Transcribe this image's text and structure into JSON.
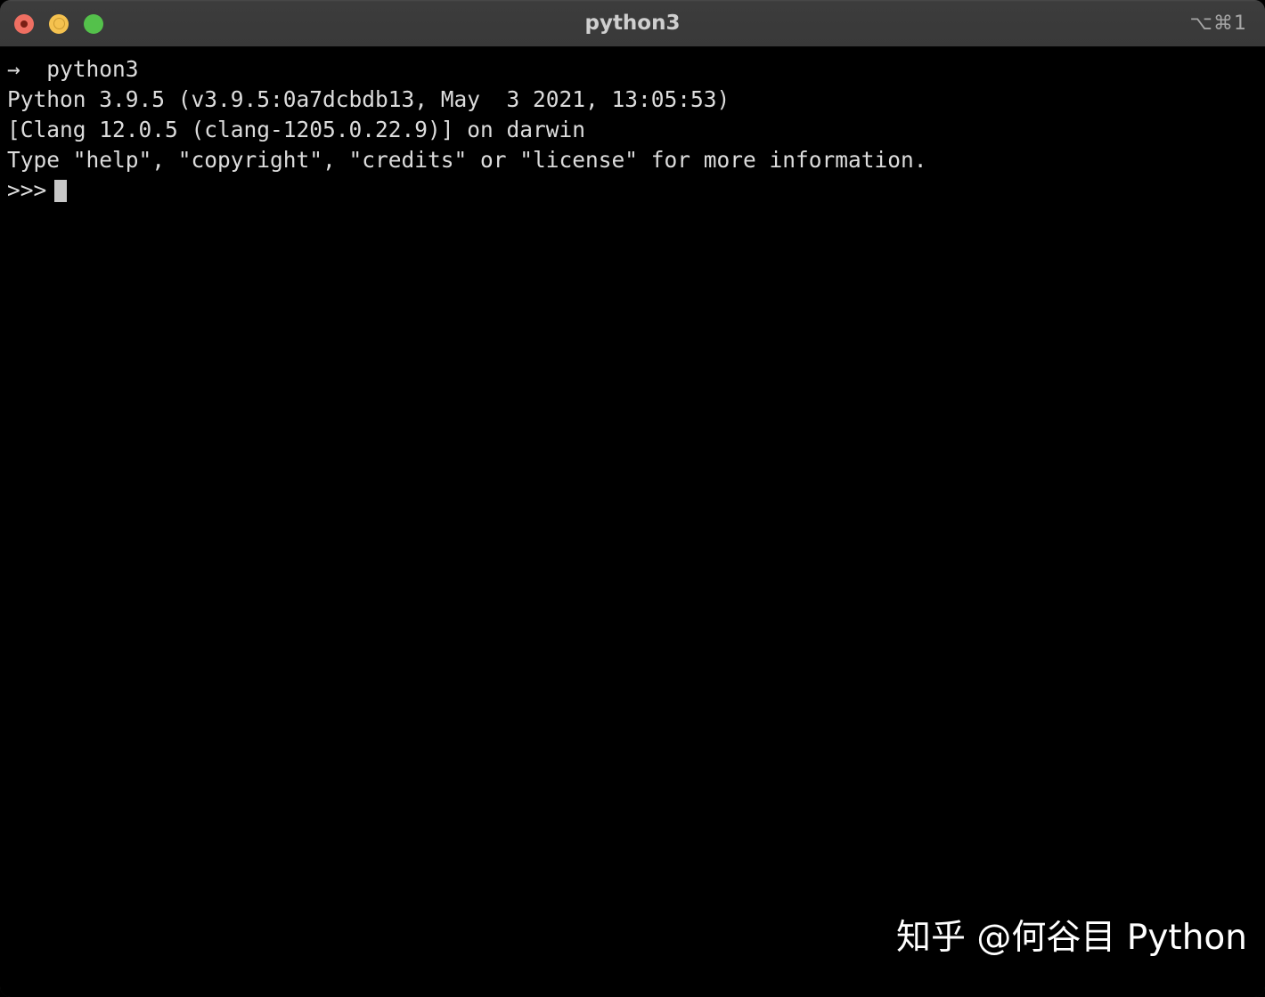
{
  "window": {
    "title": "python3",
    "shortcut_hint": "⌥⌘1",
    "controls": [
      {
        "name": "close",
        "label": "Close",
        "color": "#ef6f62"
      },
      {
        "name": "minimize",
        "label": "Minimize",
        "color": "#f5c24f"
      },
      {
        "name": "maximize",
        "label": "Maximize",
        "color": "#54c14b"
      }
    ]
  },
  "terminal": {
    "background": "#000000",
    "foreground": "#dcdcdc",
    "lines": [
      "→  python3",
      "Python 3.9.5 (v3.9.5:0a7dcbdb13, May  3 2021, 13:05:53)",
      "[Clang 12.0.5 (clang-1205.0.22.9)] on darwin",
      "Type \"help\", \"copyright\", \"credits\" or \"license\" for more information."
    ],
    "prompt": ">>>",
    "input_value": "",
    "cursor_color": "#c8c8c8"
  },
  "watermark": {
    "text": "知乎 @何谷目 Python"
  }
}
